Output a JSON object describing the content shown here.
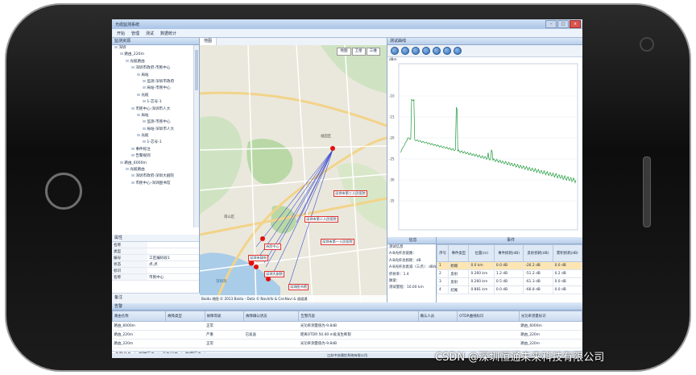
{
  "window": {
    "title": "光缆监测系统",
    "min_label": "–",
    "max_label": "□",
    "close_label": "×"
  },
  "menu": [
    "开始",
    "管理",
    "测试",
    "数据统计"
  ],
  "left_panel": {
    "title": "监测资源",
    "tree": [
      {
        "indent": 0,
        "text": "深圳"
      },
      {
        "indent": 1,
        "text": "路由_220m"
      },
      {
        "indent": 2,
        "text": "光缆路由"
      },
      {
        "indent": 3,
        "text": "深圳市政府-市民中心"
      },
      {
        "indent": 4,
        "text": "局站"
      },
      {
        "indent": 5,
        "text": "监测-深圳市政府"
      },
      {
        "indent": 5,
        "text": "局站-市民中心"
      },
      {
        "indent": 4,
        "text": "光缆"
      },
      {
        "indent": 5,
        "text": "1-芯号-1"
      },
      {
        "indent": 3,
        "text": "市民中心-深圳市人大"
      },
      {
        "indent": 4,
        "text": "局站"
      },
      {
        "indent": 5,
        "text": "监测-市民中心"
      },
      {
        "indent": 5,
        "text": "局站-深圳市人大"
      },
      {
        "indent": 4,
        "text": "光缆"
      },
      {
        "indent": 5,
        "text": "1-芯号-1"
      },
      {
        "indent": 3,
        "text": "事件标注"
      },
      {
        "indent": 3,
        "text": "告警规则"
      },
      {
        "indent": 1,
        "text": "路由_6000m"
      },
      {
        "indent": 2,
        "text": "光缆路由"
      },
      {
        "indent": 3,
        "text": "深圳市政府-深圳大剧院"
      },
      {
        "indent": 3,
        "text": "市民中心-深圳图书馆"
      }
    ],
    "props_title": "属性",
    "props": [
      {
        "k": "名称",
        "v": ""
      },
      {
        "k": "类型",
        "v": ""
      },
      {
        "k": "编号",
        "v": "工区编码段1"
      },
      {
        "k": "状态",
        "v": "点,点"
      },
      {
        "k": "标识",
        "v": ""
      },
      {
        "k": "名称",
        "v": "市民中心"
      }
    ],
    "notes_label": "备注"
  },
  "map_panel": {
    "tab": "地图",
    "map_types": [
      "地图",
      "卫星",
      "三维"
    ],
    "labels": [
      "深圳市第二人民医院",
      "深圳市第二人民医院",
      "深圳市第一人民医院",
      "市民中心",
      "深圳市政府",
      "深圳大剧院",
      "深圳图书馆",
      "南山区",
      "福田区",
      "深圳湾"
    ],
    "footer": "Baidu 地图 © 2013 Baidu - Data © NavInfo & CenNavi & 道道通"
  },
  "right_panel": {
    "title": "测试曲线",
    "y_unit": "dBm",
    "summary_title": "信息",
    "summary": [
      "测试信息",
      "A-B光纤总链路：",
      "A-B光纤总损耗：dB",
      "A-B光纤总衰减（三点）：dB/km",
      "折射率：1.4",
      "脉宽：",
      "测试量程：10.00 km"
    ],
    "events_title": "事件",
    "event_headers": [
      "序号",
      "事件类型",
      "位置(m)",
      "事件损耗(dB)",
      "反射损耗(dB)",
      "累积损耗(dB)"
    ],
    "events": [
      [
        "1",
        "始端",
        "0.0 km",
        "0.0 dB",
        "-26.2 dB",
        "0.0 dB"
      ],
      [
        "2",
        "反射",
        "0.260 km",
        "1.2 dB",
        "-51.2 dB",
        "0.2 dB"
      ],
      [
        "3",
        "反射",
        "0.260 km",
        "0.5 dB",
        "-61.3 dB",
        "0.0 dB"
      ],
      [
        "4",
        "结尾",
        "0.881 km",
        "0.0 dB",
        "-66.8 dB",
        "0.0 dB"
      ]
    ]
  },
  "alarm_panel": {
    "title": "告警",
    "headers": [
      "路由名称",
      "故障类型",
      "故障等级",
      "故障确认状态",
      "告警内容",
      "确认人员",
      "OTDR曲线标识",
      "光功率测量标识"
    ],
    "rows": [
      [
        "路由_6000m",
        "",
        "正常",
        "",
        "光功率测量值为-9.8dB",
        "",
        "",
        "路由_6000m"
      ],
      [
        "路由_220m",
        "",
        "严重",
        "已发送",
        "距离OTDR 50.00 m处发生断裂",
        "",
        "",
        "路由_220m"
      ],
      [
        "路由_220m",
        "",
        "正常",
        "",
        "光功率测量值为-9.8dB",
        "",
        "",
        "路由_220m"
      ]
    ],
    "tabs": [
      "告警信息",
      "故障历史",
      "设备状态",
      "数据历史"
    ],
    "status": "江苏中创通信系统有限公司"
  },
  "watermark": "CSDN @深圳恒通未来科技有限公司",
  "chart_data": {
    "type": "line",
    "title": "",
    "xlabel": "",
    "ylabel": "dBm",
    "y_ticks": [
      "-10",
      "-15",
      "-20",
      "-25",
      "-30",
      "-35"
    ],
    "events_x_fraction": [
      0.07,
      0.32,
      0.5,
      0.52
    ]
  }
}
